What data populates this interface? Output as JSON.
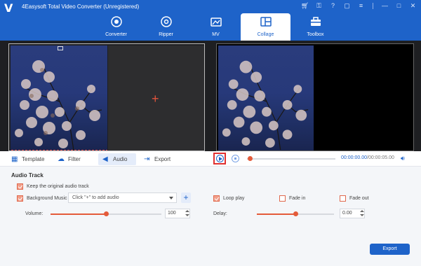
{
  "app": {
    "title": "4Easysoft Total Video Converter (Unregistered)"
  },
  "window_controls": [
    "cart-icon",
    "key-icon",
    "question-icon",
    "chat-icon",
    "menu-icon",
    "minimize-icon",
    "maximize-icon",
    "close-icon"
  ],
  "nav": {
    "items": [
      {
        "label": "Converter",
        "icon": "converter-icon",
        "active": false
      },
      {
        "label": "Ripper",
        "icon": "ripper-icon",
        "active": false
      },
      {
        "label": "MV",
        "icon": "mv-icon",
        "active": false
      },
      {
        "label": "Collage",
        "icon": "collage-icon",
        "active": true
      },
      {
        "label": "Toolbox",
        "icon": "toolbox-icon",
        "active": false
      }
    ]
  },
  "editor_tabs": {
    "template": "Template",
    "filter": "Filter",
    "audio": "Audio",
    "export": "Export",
    "active": "Audio"
  },
  "playback": {
    "current_time": "00:00:00.00",
    "separator": "/",
    "total_time": "00:00:05.00",
    "progress": 0
  },
  "audio": {
    "section_title": "Audio Track",
    "keep_original_label": "Keep the original audio track",
    "keep_original_checked": true,
    "background_music_label": "Background Music",
    "background_music_checked": true,
    "background_music_placeholder": "Click \"+\" to add audio",
    "loop_play_label": "Loop play",
    "loop_play_checked": true,
    "fade_in_label": "Fade in",
    "fade_in_checked": false,
    "fade_out_label": "Fade out",
    "fade_out_checked": false,
    "volume_label": "Volume:",
    "volume_value": "100",
    "volume_fraction": 0.5,
    "delay_label": "Delay:",
    "delay_value": "0.00",
    "delay_fraction": 0.5
  },
  "footer": {
    "export_label": "Export"
  },
  "colors": {
    "brand": "#1e63c9",
    "accent": "#e45b3a",
    "highlight_border": "#e03030"
  }
}
